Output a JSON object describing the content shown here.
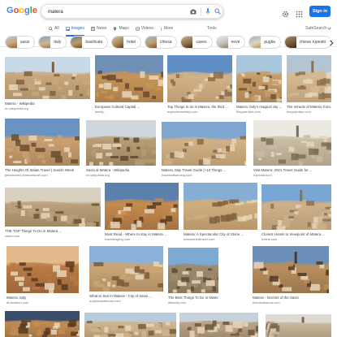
{
  "header": {
    "logo": "Google",
    "search_value": "matera",
    "signin_label": "Sign in"
  },
  "tabs": [
    {
      "label": "All",
      "icon": "search-icon"
    },
    {
      "label": "Images",
      "icon": "image-icon",
      "active": true
    },
    {
      "label": "News",
      "icon": "news-icon"
    },
    {
      "label": "Maps",
      "icon": "map-pin-icon"
    },
    {
      "label": "Videos",
      "icon": "video-icon"
    },
    {
      "label": "More",
      "icon": "more-vert-icon"
    }
  ],
  "tools_label": "Tools",
  "safesearch_label": "SafeSearch",
  "chips": [
    "sassi",
    "italy",
    "basilicata",
    "hotel",
    "chiesa",
    "caves",
    "neve",
    "puglia",
    "chiese rupestri"
  ],
  "results": [
    {
      "title": "Matera - Wikipedia",
      "source": "en.wikipedia.org"
    },
    {
      "title": "European Cultural Capital ...",
      "source": "lonely..."
    },
    {
      "title": "Top Things to do in Matera, the third ...",
      "source": "exploretraveltaly.com"
    },
    {
      "title": "Matera: Italy's magical city ...",
      "source": "theguardian.com"
    },
    {
      "title": "The miracle of Matera: from...",
      "source": "theguardian.com"
    },
    {
      "title": "The Heights Of Italian Travel | Jewish Week",
      "source": "jewishweek.timesofisrael.com"
    },
    {
      "title": "Sassi di Matera - Wikipedia",
      "source": "en.wikipedia.org"
    },
    {
      "title": "Matera, Italy Travel Guide [+10 Things ...",
      "source": "travelsofilanning.com"
    },
    {
      "title": "Visit Matera: 2021 Travel Guide for ...",
      "source": "expedia.com"
    },
    {
      "title": "THE TOP Things To Do in Matera ...",
      "source": "viator.com"
    },
    {
      "title": "Must Read - Where to stay in Matera ...",
      "source": "travelbloging.com"
    },
    {
      "title": "Matera: A Spectacular City of Stone ...",
      "source": "mooserhedtravel.com"
    },
    {
      "title": "Closest Hotels to Viewpoint of Matera ...",
      "source": "hotels.com"
    },
    {
      "title": "Matera, Italy",
      "source": "itv.aviation.com"
    },
    {
      "title": "What to See in Matera - City of Sassi ...",
      "source": "pugliacanalitours.com"
    },
    {
      "title": "The Best Things To Do in Matera | Italy ...",
      "source": "afternily.com"
    },
    {
      "title": "Matera - Secrets of the Sassi",
      "source": "theroadtourna.com"
    }
  ],
  "colors": {
    "accent": "#1a73e8",
    "logo_blue": "#4285f4",
    "logo_red": "#ea4335",
    "logo_yellow": "#fbbc05",
    "logo_green": "#34a853"
  }
}
